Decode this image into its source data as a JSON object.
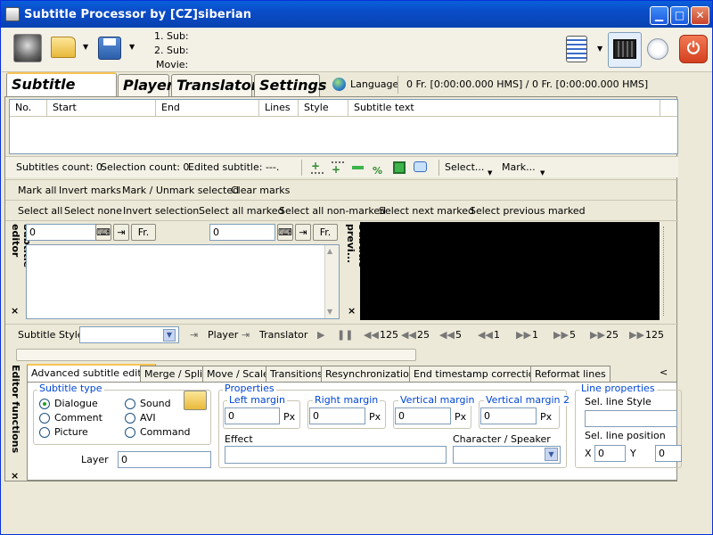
{
  "window": {
    "title": "Subtitle Processor by [CZ]siberian"
  },
  "toolbar": {
    "sub1_label": "1. Sub:",
    "sub2_label": "2. Sub:",
    "movie_label": "Movie:"
  },
  "tabs": [
    {
      "label": "Subtitle Editor",
      "selected": true
    },
    {
      "label": "Player"
    },
    {
      "label": "Translator"
    },
    {
      "label": "Settings"
    }
  ],
  "language": {
    "label": "Language"
  },
  "frame_status": "0 Fr. [0:00:00.000 HMS] / 0 Fr. [0:00:00.000 HMS]",
  "table": {
    "columns": [
      "No.",
      "Start",
      "End",
      "Lines",
      "Style",
      "Subtitle text"
    ],
    "rows": []
  },
  "status": {
    "subtitles_count": "Subtitles count: 0.",
    "selection_count": "Selection count: 0.",
    "edited_subtitle": "Edited subtitle: ---.",
    "select_menu": "Select...",
    "mark_menu": "Mark..."
  },
  "mark_row": [
    "Mark all",
    "Invert marks",
    "Mark / Unmark selected",
    "Clear marks"
  ],
  "select_row": [
    "Select all",
    "Select none",
    "Invert selection",
    "Select all marked",
    "Select all non-marked",
    "Select next marked",
    "Select previous marked"
  ],
  "editor": {
    "start_value": "0",
    "end_value": "0",
    "fr_label": "Fr.",
    "side_label": "Subtitle editor",
    "preview_label": "Subtitle previ...",
    "functions_label": "Editor functions",
    "close_glyph": "×"
  },
  "nav_row": {
    "style_label": "Subtitle Style",
    "player": "Player",
    "translator": "Translator",
    "steps": [
      "125",
      "25",
      "5",
      "1",
      "1",
      "5",
      "25",
      "125"
    ]
  },
  "editor_tabs": [
    "Advanced subtitle editor",
    "Merge / Split",
    "Move / Scale",
    "Transitions",
    "Resynchronization",
    "End timestamp corrections",
    "Reformat lines"
  ],
  "editor_tabs_scroll": "<",
  "subtitle_type": {
    "title": "Subtitle type",
    "options": [
      "Dialogue",
      "Comment",
      "Picture",
      "Sound",
      "AVI",
      "Command"
    ],
    "selected": "Dialogue"
  },
  "layer": {
    "label": "Layer",
    "value": "0"
  },
  "properties": {
    "title": "Properties",
    "left_margin": {
      "label": "Left margin",
      "value": "0",
      "unit": "Px"
    },
    "right_margin": {
      "label": "Right margin",
      "value": "0",
      "unit": "Px"
    },
    "vertical_margin": {
      "label": "Vertical margin",
      "value": "0",
      "unit": "Px"
    },
    "vertical_margin2": {
      "label": "Vertical margin 2",
      "value": "0",
      "unit": "Px"
    },
    "effect_label": "Effect",
    "character_label": "Character / Speaker"
  },
  "line_properties": {
    "title": "Line properties",
    "sel_style": "Sel. line Style",
    "sel_position": "Sel. line position",
    "x_label": "X",
    "x_value": "0",
    "y_label": "Y",
    "y_value": "0"
  }
}
